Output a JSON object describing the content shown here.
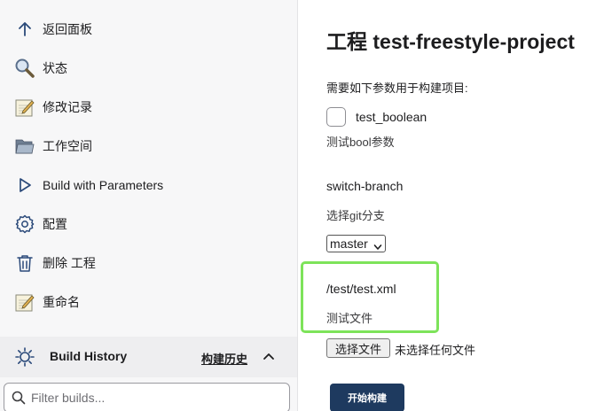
{
  "sidebar": {
    "items": [
      {
        "label": "返回面板",
        "icon": "arrow-up-icon"
      },
      {
        "label": "状态",
        "icon": "magnifier-icon"
      },
      {
        "label": "修改记录",
        "icon": "notepad-icon"
      },
      {
        "label": "工作空间",
        "icon": "folder-icon"
      },
      {
        "label": "Build with Parameters",
        "icon": "play-outline-icon"
      },
      {
        "label": "配置",
        "icon": "gear-icon"
      },
      {
        "label": "删除 工程",
        "icon": "trash-icon"
      },
      {
        "label": "重命名",
        "icon": "notepad-icon"
      }
    ],
    "build_history": {
      "title": "Build History",
      "link": "构建历史",
      "icon": "build-history-icon"
    },
    "filter": {
      "placeholder": "Filter builds...",
      "value": ""
    }
  },
  "main": {
    "title": "工程 test-freestyle-project",
    "intro": "需要如下参数用于构建项目:",
    "params": {
      "boolean": {
        "name": "test_boolean",
        "checked": false,
        "description": "测试bool参数"
      },
      "choice": {
        "name": "switch-branch",
        "description": "选择git分支",
        "selected": "master"
      },
      "file": {
        "name": "/test/test.xml",
        "description": "测试文件",
        "button_label": "选择文件",
        "status": "未选择任何文件"
      }
    },
    "build_button": "开始构建"
  },
  "colors": {
    "highlight_border": "#7de35a",
    "primary_button": "#1e3a5f",
    "sidebar_bg": "#f7f7f8"
  }
}
